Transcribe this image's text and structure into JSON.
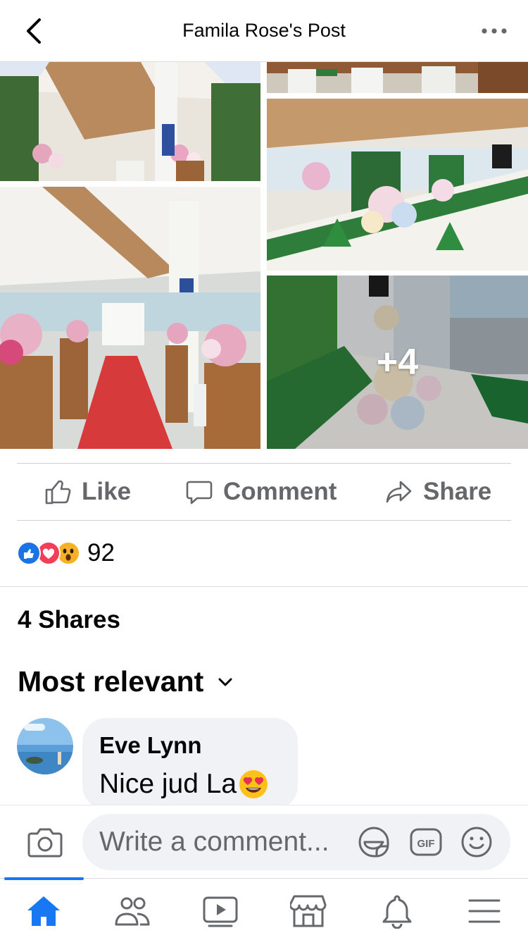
{
  "header": {
    "title": "Famila Rose's Post"
  },
  "photos": {
    "more_count_label": "+4"
  },
  "actions": {
    "like_label": "Like",
    "comment_label": "Comment",
    "share_label": "Share"
  },
  "reactions": {
    "types": [
      "like-icon",
      "love-icon",
      "wow-icon"
    ],
    "count": "92"
  },
  "shares": {
    "label": "4 Shares"
  },
  "sort": {
    "label": "Most relevant"
  },
  "comments": [
    {
      "author": "Eve Lynn",
      "text": "Nice jud La",
      "emoji": "heart-eyes-icon"
    }
  ],
  "composer": {
    "placeholder": "Write a comment..."
  },
  "nav": {
    "items": [
      "home-icon",
      "friends-icon",
      "watch-icon",
      "marketplace-icon",
      "notifications-icon",
      "menu-icon"
    ],
    "active": "home-icon"
  },
  "colors": {
    "brand_blue": "#1877f2",
    "secondary_text": "#65676b",
    "like_blue": "#1b74e4",
    "love_red": "#f33e58",
    "wow_yellow": "#f7b125"
  }
}
